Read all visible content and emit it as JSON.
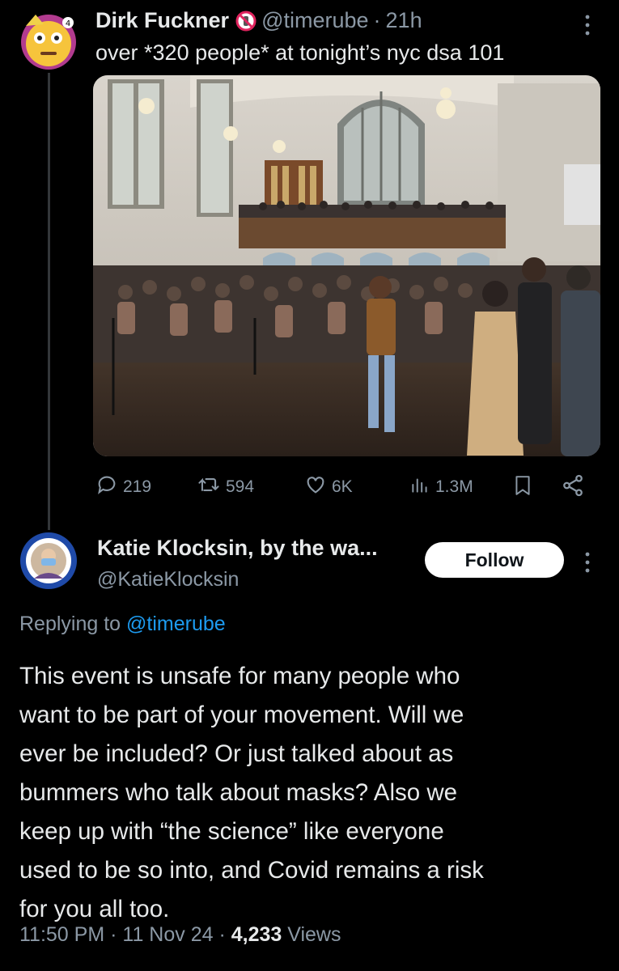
{
  "tweet": {
    "author_name": "Dirk Fuckner",
    "handle": "@timerube",
    "separator": "·",
    "time_ago": "21h",
    "text": "over *320 people* at tonight’s nyc dsa 101",
    "stats": {
      "replies": "219",
      "retweets": "594",
      "likes": "6K",
      "views": "1.3M"
    },
    "icons": {
      "badge": "no-entry-icon",
      "reply": "comment-icon",
      "retweet": "retweet-icon",
      "like": "heart-icon",
      "views": "bar-chart-icon",
      "bookmark": "bookmark-icon",
      "share": "share-icon",
      "more": "more-vertical-icon"
    }
  },
  "reply": {
    "author_name": "Katie Klocksin, by the wa...",
    "handle": "@KatieKlocksin",
    "follow_label": "Follow",
    "replying_prefix": "Replying to",
    "replying_to": "@timerube",
    "text_lines": [
      "This event is unsafe for many people who",
      "want to be part of your movement. Will we",
      "ever be included? Or just talked about as",
      "bummers who talk about masks? Also we",
      "keep up with “the science” like everyone",
      "used to be so into, and Covid remains a risk",
      "for you all too."
    ],
    "time": "11:50 PM",
    "date": "11 Nov 24",
    "separator": "·",
    "views_count": "4,233",
    "views_label": "Views"
  },
  "colors": {
    "background": "#000000",
    "text": "#e7e9ea",
    "muted": "#8b98a5",
    "link": "#1d9bf0",
    "follow_bg": "#ffffff"
  }
}
